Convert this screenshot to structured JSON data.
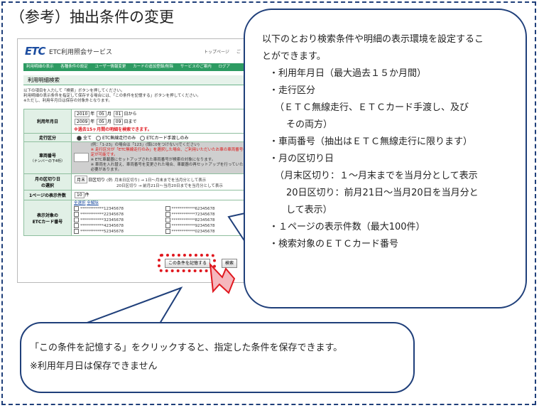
{
  "heading": "（参考）抽出条件の変更",
  "app": {
    "logo": "ETC",
    "title": "ETC利用照会サービス",
    "top_links": [
      "トップページ",
      "ご"
    ],
    "nav": [
      "利用明細の表示",
      "各種条件の設定",
      "ユーザー情報変更",
      "カードの追加登録/削除",
      "サービスのご案内",
      "ログア"
    ],
    "section_title": "利用明細検索",
    "intro": [
      "以下の項目を入力して「検索」ボタンを押してください。",
      "利用明細の表示条件を指定して保存する場合には、「この条件を記憶する」ボタンを押してください。",
      "※ただし、利用年月日は保存の対象外となります。"
    ],
    "date_label": "利用年月日",
    "date_from": {
      "year": "2010",
      "year_unit": "年",
      "month": "05",
      "month_unit": "月",
      "day": "01",
      "suffix": "日から"
    },
    "date_to": {
      "year": "2009",
      "year_unit": "年",
      "month": "05",
      "month_unit": "月",
      "day": "09",
      "suffix": "日まで"
    },
    "date_warning": "※過去15ヶ月間の明細を検索できます。",
    "travel_label": "走行区分",
    "travel_options": [
      "全て",
      "ETC無線走行のみ",
      "ETCカード手渡しのみ"
    ],
    "vehicle_label": "車両番号",
    "vehicle_label_sub": "（ナンバーの下4桁）",
    "vehicle_notes": [
      "(例：「1-23」の場合は「123」(頭に0をつけない)でください)",
      "※ 走行区分が「ETC無線走行のみ」を選択した場合、ご利用いただいたお車の車両番号の指定が可能です。",
      "※ ETC車載器にセットアップされた車両番号が検索の対象になります。",
      "※ 車両を入れ替え、車両番号を変更された場合、車載器の再セットアップを行っていただく必要があります。"
    ],
    "cutoff_label": "月の区切り日",
    "cutoff_label_sub": "の選択",
    "cutoff_value": "月末",
    "cutoff_suffix": "日区切り",
    "cutoff_example_1": "(例: 月末日区切り) → 1日～月末までを当月分として表示",
    "cutoff_example_2": "20日区切り → 前月21日～当月20日までを当月分として表示",
    "perpage_label": "1ページの表示件数",
    "perpage_value": "10",
    "perpage_unit": "件",
    "cards_label": "表示対象の",
    "cards_label_2": "ETCカード番号",
    "select_all": "全選択",
    "deselect_all": "全解除",
    "cards_left": [
      "************12345678",
      "************22345678",
      "************32345678",
      "************42345678",
      "************52345678"
    ],
    "cards_right": [
      "************62345678",
      "************72345678",
      "************82345678",
      "************92345678",
      "************02345678"
    ],
    "save_button": "この条件を記憶する",
    "search_button": "検索"
  },
  "callout_right": [
    "以下のとおり検索条件や明細の表示環境を設定するこ",
    "とができます。",
    "・利用年月日（最大過去１５か月間）",
    "・走行区分",
    "（ＥＴＣ無線走行、ＥＴＣカード手渡し、及び",
    "その両方）",
    "・車両番号（抽出はＥＴＣ無線走行に限ります）",
    "・月の区切り日",
    "（月末区切り：１～月末までを当月分として表示",
    "20日区切り：前月21日～当月20日を当月分と",
    "して表示）",
    "・１ページの表示件数（最大100件）",
    "・検索対象のＥＴＣカード番号"
  ],
  "callout_bottom": [
    "「この条件を記憶する」をクリックすると、指定した条件を保存できます。",
    "※利用年月日は保存できません"
  ]
}
